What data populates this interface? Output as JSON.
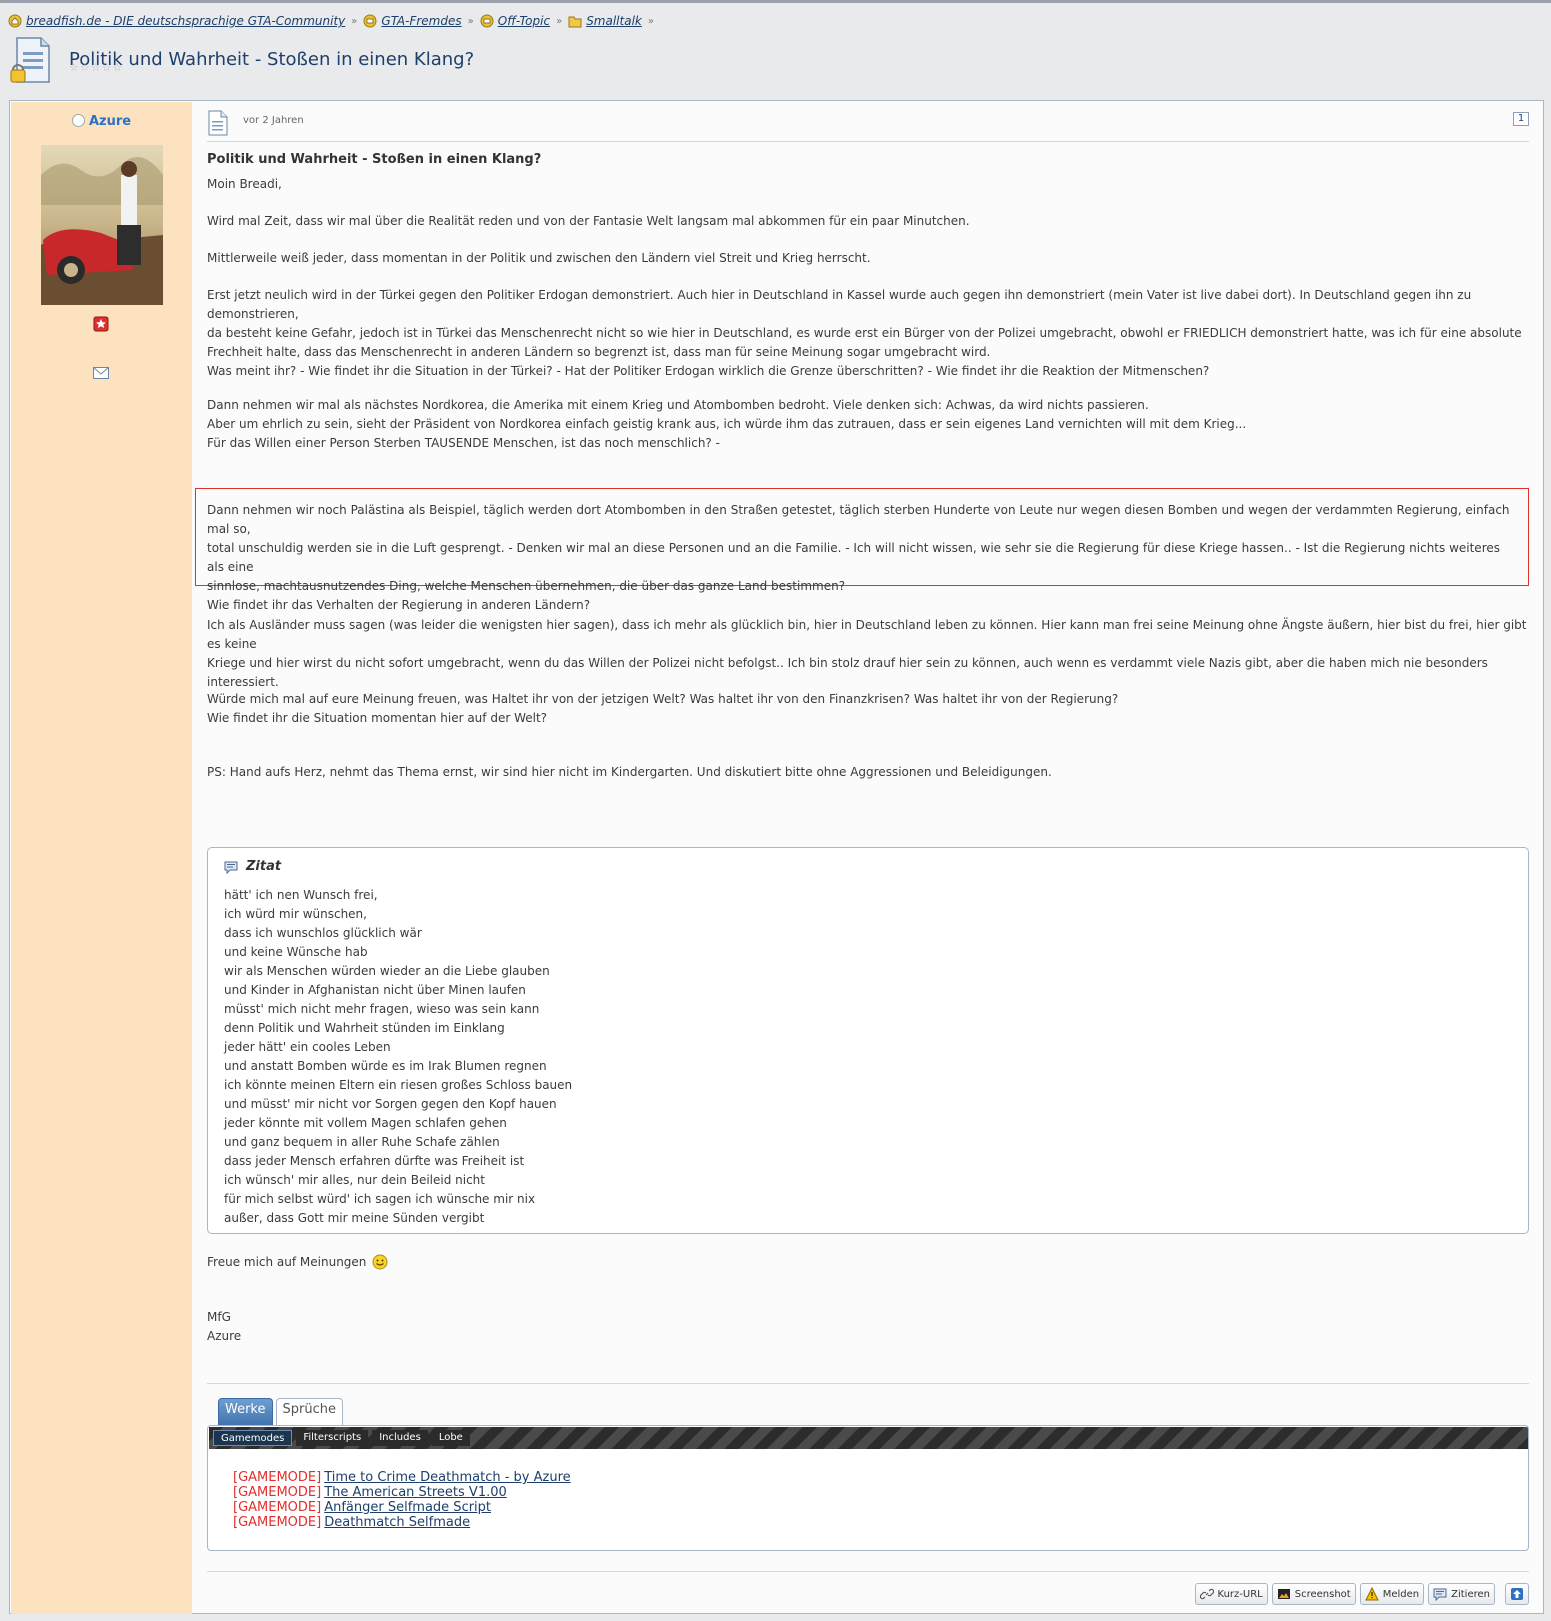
{
  "breadcrumb": [
    {
      "label": "breadfish.de - DIE deutschsprachige GTA-Community"
    },
    {
      "label": "GTA-Fremdes"
    },
    {
      "label": "Off-Topic"
    },
    {
      "label": "Smalltalk"
    }
  ],
  "thread": {
    "title": "Politik und Wahrheit - Stoßen in einen Klang?",
    "rating": "☆☆☆☆☆"
  },
  "author": {
    "name": "Azure"
  },
  "post": {
    "time": "vor 2 Jahren",
    "number": "1",
    "subject": "Politik und Wahrheit - Stoßen in einen Klang?",
    "greeting": "Moin Breadi,",
    "p1": "Wird mal Zeit, dass wir mal über die Realität reden und von der Fantasie Welt langsam mal abkommen für ein paar Minutchen.",
    "p2": "Mittlerweile weiß jeder, dass momentan in der Politik und zwischen den Ländern viel Streit und Krieg herrscht.",
    "p3_l1": "Erst jetzt neulich wird in der Türkei gegen den Politiker Erdogan demonstriert. Auch hier in Deutschland in Kassel wurde auch gegen ihn demonstriert (mein Vater ist live dabei dort). In Deutschland gegen ihn zu demonstrieren,",
    "p3_l2": "da besteht keine Gefahr, jedoch ist in Türkei das Menschenrecht nicht so wie hier in Deutschland, es wurde erst ein Bürger von der Polizei umgebracht, obwohl er FRIEDLICH demonstriert hatte, was ich für eine absolute",
    "p3_l3": "Frechheit halte, dass das Menschenrecht in anderen Ländern so begrenzt ist, dass man für seine Meinung sogar umgebracht wird.",
    "p3_l4": "Was meint ihr? - Wie findet ihr die Situation in der Türkei? - Hat der Politiker Erdogan wirklich die Grenze überschritten? - Wie findet ihr die Reaktion der Mitmenschen?",
    "p4_l1": "Dann nehmen wir mal als nächstes Nordkorea, die Amerika mit einem Krieg und Atombomben bedroht. Viele denken sich: Achwas, da wird nichts passieren.",
    "p4_l2": "Aber um ehrlich zu sein, sieht der Präsident von Nordkorea einfach geistig krank aus, ich würde ihm das zutrauen, dass er sein eigenes Land vernichten will mit dem Krieg...",
    "p4_l3": "Für das Willen einer Person Sterben TAUSENDE Menschen, ist das noch menschlich? -",
    "p5_l1": "Dann nehmen wir noch Palästina als Beispiel, täglich werden dort Atombomben in den Straßen getestet, täglich sterben Hunderte von Leute nur wegen diesen Bomben und wegen der verdammten Regierung, einfach mal so,",
    "p5_l2": "total unschuldig werden sie in die Luft gesprengt. - Denken wir mal an diese Personen und an die Familie. - Ich will nicht wissen, wie sehr sie die Regierung für diese Kriege hassen.. - Ist die Regierung nichts weiteres als eine",
    "p5_l3": "sinnlose, machtausnutzendes Ding, welche Menschen übernehmen, die über das ganze Land bestimmen?",
    "p5_l4": "Wie findet ihr das Verhalten der Regierung in anderen Ländern?",
    "p6_l1": "Ich als Ausländer muss sagen (was leider die wenigsten hier sagen), dass ich mehr als glücklich bin, hier in Deutschland leben zu können. Hier kann man frei seine Meinung ohne Ängste äußern, hier bist du frei, hier gibt es keine",
    "p6_l2": "Kriege und hier wirst du nicht sofort umgebracht, wenn du das Willen der Polizei nicht befolgst.. Ich bin stolz drauf hier sein zu können, auch wenn es verdammt viele Nazis gibt, aber die haben mich nie besonders interessiert.",
    "p7_l1": "Würde mich mal auf eure Meinung freuen, was Haltet ihr von der jetzigen Welt? Was haltet ihr von den Finanzkrisen? Was haltet ihr von der Regierung?",
    "p7_l2": "Wie findet ihr die Situation momentan hier auf der Welt?",
    "p8": "PS: Hand aufs Herz, nehmt das Thema ernst, wir sind hier nicht im Kindergarten. Und diskutiert bitte ohne Aggressionen und Beleidigungen.",
    "quote_title": "Zitat",
    "quote_lines": [
      "hätt' ich nen Wunsch frei,",
      "ich würd mir wünschen,",
      "dass ich wunschlos glücklich wär",
      "und keine Wünsche hab",
      "wir als Menschen würden wieder an die Liebe glauben",
      "und Kinder in Afghanistan nicht über Minen laufen",
      "müsst' mich nicht mehr fragen, wieso was sein kann",
      "denn Politik und Wahrheit stünden im Einklang",
      "jeder hätt' ein cooles Leben",
      "und anstatt Bomben würde es im Irak Blumen regnen",
      "ich könnte meinen Eltern ein riesen großes Schloss bauen",
      "und müsst' mir nicht vor Sorgen gegen den Kopf hauen",
      "jeder könnte mit vollem Magen schlafen gehen",
      "und ganz bequem in aller Ruhe Schafe zählen",
      "dass jeder Mensch erfahren dürfte was Freiheit ist",
      "ich wünsch' mir alles, nur dein Beileid nicht",
      "für mich selbst würd' ich sagen ich wünsche mir nix",
      "außer, dass Gott mir meine Sünden vergibt"
    ],
    "closing": "Freue mich auf Meinungen",
    "signoff": "MfG",
    "signoff_name": "Azure"
  },
  "signature": {
    "tabs": [
      "Werke",
      "Sprüche"
    ],
    "subtabs": [
      "Gamemodes",
      "Filterscripts",
      "Includes",
      "Lobe"
    ],
    "items": [
      {
        "tag": "[GAMEMODE]",
        "title": "Time to Crime Deathmatch - by Azure"
      },
      {
        "tag": "[GAMEMODE]",
        "title": "The American Streets V1.00"
      },
      {
        "tag": "[GAMEMODE]",
        "title": "Anfänger Selfmade Script"
      },
      {
        "tag": "[GAMEMODE]",
        "title": "Deathmatch Selfmade"
      }
    ]
  },
  "actions": {
    "shorturl": "Kurz-URL",
    "screenshot": "Screenshot",
    "report": "Melden",
    "quote": "Zitieren"
  },
  "colors": {
    "sidebar": "#fde2bf",
    "link": "#1d3f6b",
    "username": "#2a72c8",
    "highlight_border": "#e0302e"
  }
}
